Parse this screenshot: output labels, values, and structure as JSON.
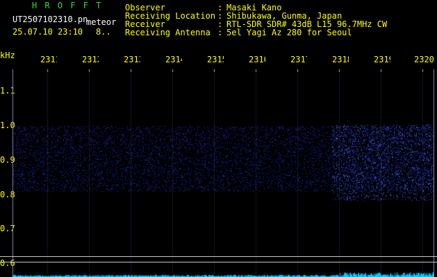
{
  "header": {
    "title": "H R O F F T",
    "filename": "UT2507102310.pn",
    "mode": "meteor",
    "datetime": "25.07.10 23:10",
    "count": "8.."
  },
  "station": {
    "fields": [
      {
        "label": "Observer",
        "value": "Masaki Kano"
      },
      {
        "label": "Receiving Location",
        "value": "Shibukawa, Gunma, Japan"
      },
      {
        "label": "Receiver",
        "value": "RTL-SDR SDR# 43dB L15 96.7MHz CW"
      },
      {
        "label": "Receiving Antenna",
        "value": "5el Yagi Az 280 for Seoul"
      }
    ],
    "separator": ":"
  },
  "axes": {
    "unit": "kHz",
    "time_ticks": [
      "2311",
      "2312",
      "2313",
      "2314",
      "2315",
      "2316",
      "2317",
      "2318",
      "2319",
      "2320"
    ],
    "freq_ticks": [
      "1.1",
      "1.0",
      "0.9",
      "0.8",
      "0.7",
      "0.6"
    ]
  },
  "colors": {
    "title": "#33dd33",
    "labels": "#ffff00",
    "text": "#ffffff",
    "signal": "#2a3cff",
    "noise_floor": "#00c8ff"
  }
}
